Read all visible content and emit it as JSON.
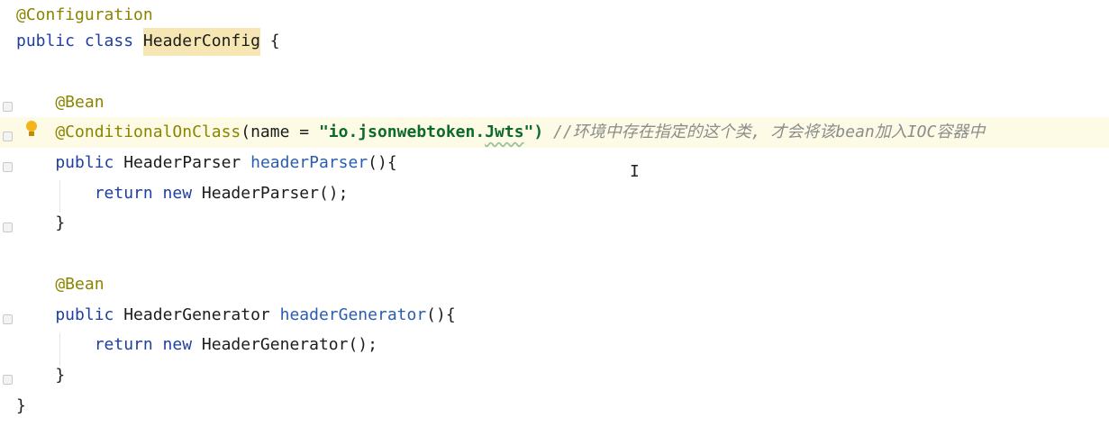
{
  "editor": {
    "lines": [
      {
        "tokens": [
          {
            "t": "@Configuration",
            "c": "ann"
          }
        ]
      },
      {
        "tokens": [
          {
            "t": "public class ",
            "c": "kw"
          },
          {
            "t": "HeaderConfig",
            "c": "type hl"
          },
          {
            "t": " {",
            "c": "plain"
          }
        ]
      },
      {
        "tokens": []
      },
      {
        "tokens": [
          {
            "t": "    @Bean",
            "c": "ann"
          }
        ]
      },
      {
        "current": true,
        "tokens": [
          {
            "t": "    @ConditionalOnClass",
            "c": "ann"
          },
          {
            "t": "(name = ",
            "c": "plain"
          },
          {
            "t": "\"io.jsonwebtoken.",
            "c": "str"
          },
          {
            "t": "Jwts",
            "c": "str squiggle"
          },
          {
            "t": "\")",
            "c": "str"
          },
          {
            "t": " //环境中存在指定的这个类, 才会将该bean加入IOC容器中",
            "c": "cmt"
          }
        ]
      },
      {
        "tokens": [
          {
            "t": "    public ",
            "c": "kw"
          },
          {
            "t": "HeaderParser ",
            "c": "type"
          },
          {
            "t": "headerParser",
            "c": "method"
          },
          {
            "t": "(){",
            "c": "plain"
          }
        ]
      },
      {
        "tokens": [
          {
            "t": "        return new ",
            "c": "kw"
          },
          {
            "t": "HeaderParser();",
            "c": "plain"
          }
        ]
      },
      {
        "tokens": [
          {
            "t": "    }",
            "c": "plain"
          }
        ]
      },
      {
        "tokens": []
      },
      {
        "tokens": [
          {
            "t": "    @Bean",
            "c": "ann"
          }
        ]
      },
      {
        "tokens": [
          {
            "t": "    public ",
            "c": "kw"
          },
          {
            "t": "HeaderGenerator ",
            "c": "type"
          },
          {
            "t": "headerGenerator",
            "c": "method"
          },
          {
            "t": "(){",
            "c": "plain"
          }
        ]
      },
      {
        "tokens": [
          {
            "t": "        return new ",
            "c": "kw"
          },
          {
            "t": "HeaderGenerator();",
            "c": "plain"
          }
        ]
      },
      {
        "tokens": [
          {
            "t": "    }",
            "c": "plain"
          }
        ]
      },
      {
        "tokens": [
          {
            "t": "}",
            "c": "plain"
          }
        ]
      }
    ],
    "intention_icon": "lightbulb-icon",
    "mouse_cursor": "text-cursor-icon",
    "mouse_cursor_glyph": "I",
    "colors": {
      "keyword": "#1f3f9e",
      "annotation": "#8a8400",
      "string": "#0c6b2c",
      "comment": "#8c8c8c",
      "method": "#2a5db0",
      "current_line": "#fdfbe6",
      "identifier_highlight": "#f5e6b3"
    }
  }
}
